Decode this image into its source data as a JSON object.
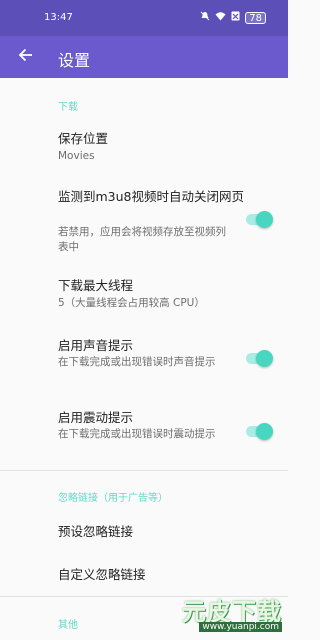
{
  "status_bar": {
    "time": "13:47",
    "icons": [
      "mute-icon",
      "wifi-icon",
      "sim-off-icon"
    ],
    "battery": "78"
  },
  "app_bar": {
    "title": "设置",
    "back_icon": "arrow-back-icon"
  },
  "sections": {
    "download": {
      "header": "下载",
      "items": [
        {
          "title": "保存位置",
          "summary": "Movies"
        },
        {
          "title": "监测到m3u8视频时自动关闭网页",
          "summary": "若禁用，应用会将视频存放至视频列表中",
          "switch_on": true
        },
        {
          "title": "下载最大线程",
          "summary": "5（大量线程会占用较高 CPU）"
        },
        {
          "title": "启用声音提示",
          "summary": "在下载完成或出现错误时声音提示",
          "switch_on": true
        },
        {
          "title": "启用震动提示",
          "summary": "在下载完成或出现错误时震动提示",
          "switch_on": true
        }
      ]
    },
    "ignore": {
      "header": "忽略链接（用于广告等）",
      "items": [
        {
          "title": "预设忽略链接"
        },
        {
          "title": "自定义忽略链接"
        }
      ]
    },
    "other": {
      "header": "其他"
    }
  },
  "watermark": {
    "logo_text": "元皮下载",
    "url": "www.yuanpi.com"
  },
  "colors": {
    "status_bar": "#5d4fb8",
    "app_bar": "#6a5acd",
    "accent": "#48d6c0",
    "section_header": "#5fdac8",
    "background": "#fafafa"
  }
}
